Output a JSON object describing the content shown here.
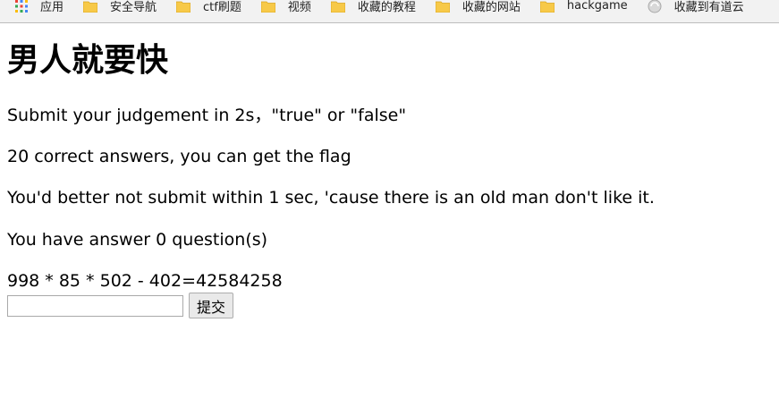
{
  "bookmarks": {
    "apps_label": "应用",
    "folders": [
      "安全导航",
      "ctf刷题",
      "视频",
      "收藏的教程",
      "收藏的网站",
      "hackgame"
    ],
    "last_item_label": "收藏到有道云",
    "folder_color": "#f7c948"
  },
  "page": {
    "title": "男人就要快",
    "instruction": "Submit your judgement in 2s，\"true\" or \"false\"",
    "goal": "20 correct answers, you can get the flag",
    "warning": "You'd better not submit within 1 sec, 'cause there is an old man don't like it.",
    "progress_text": "You have answer 0 question(s)",
    "expression": "998 * 85 * 502 - 402=42584258"
  },
  "form": {
    "answer_value": "",
    "submit_label": "提交"
  }
}
